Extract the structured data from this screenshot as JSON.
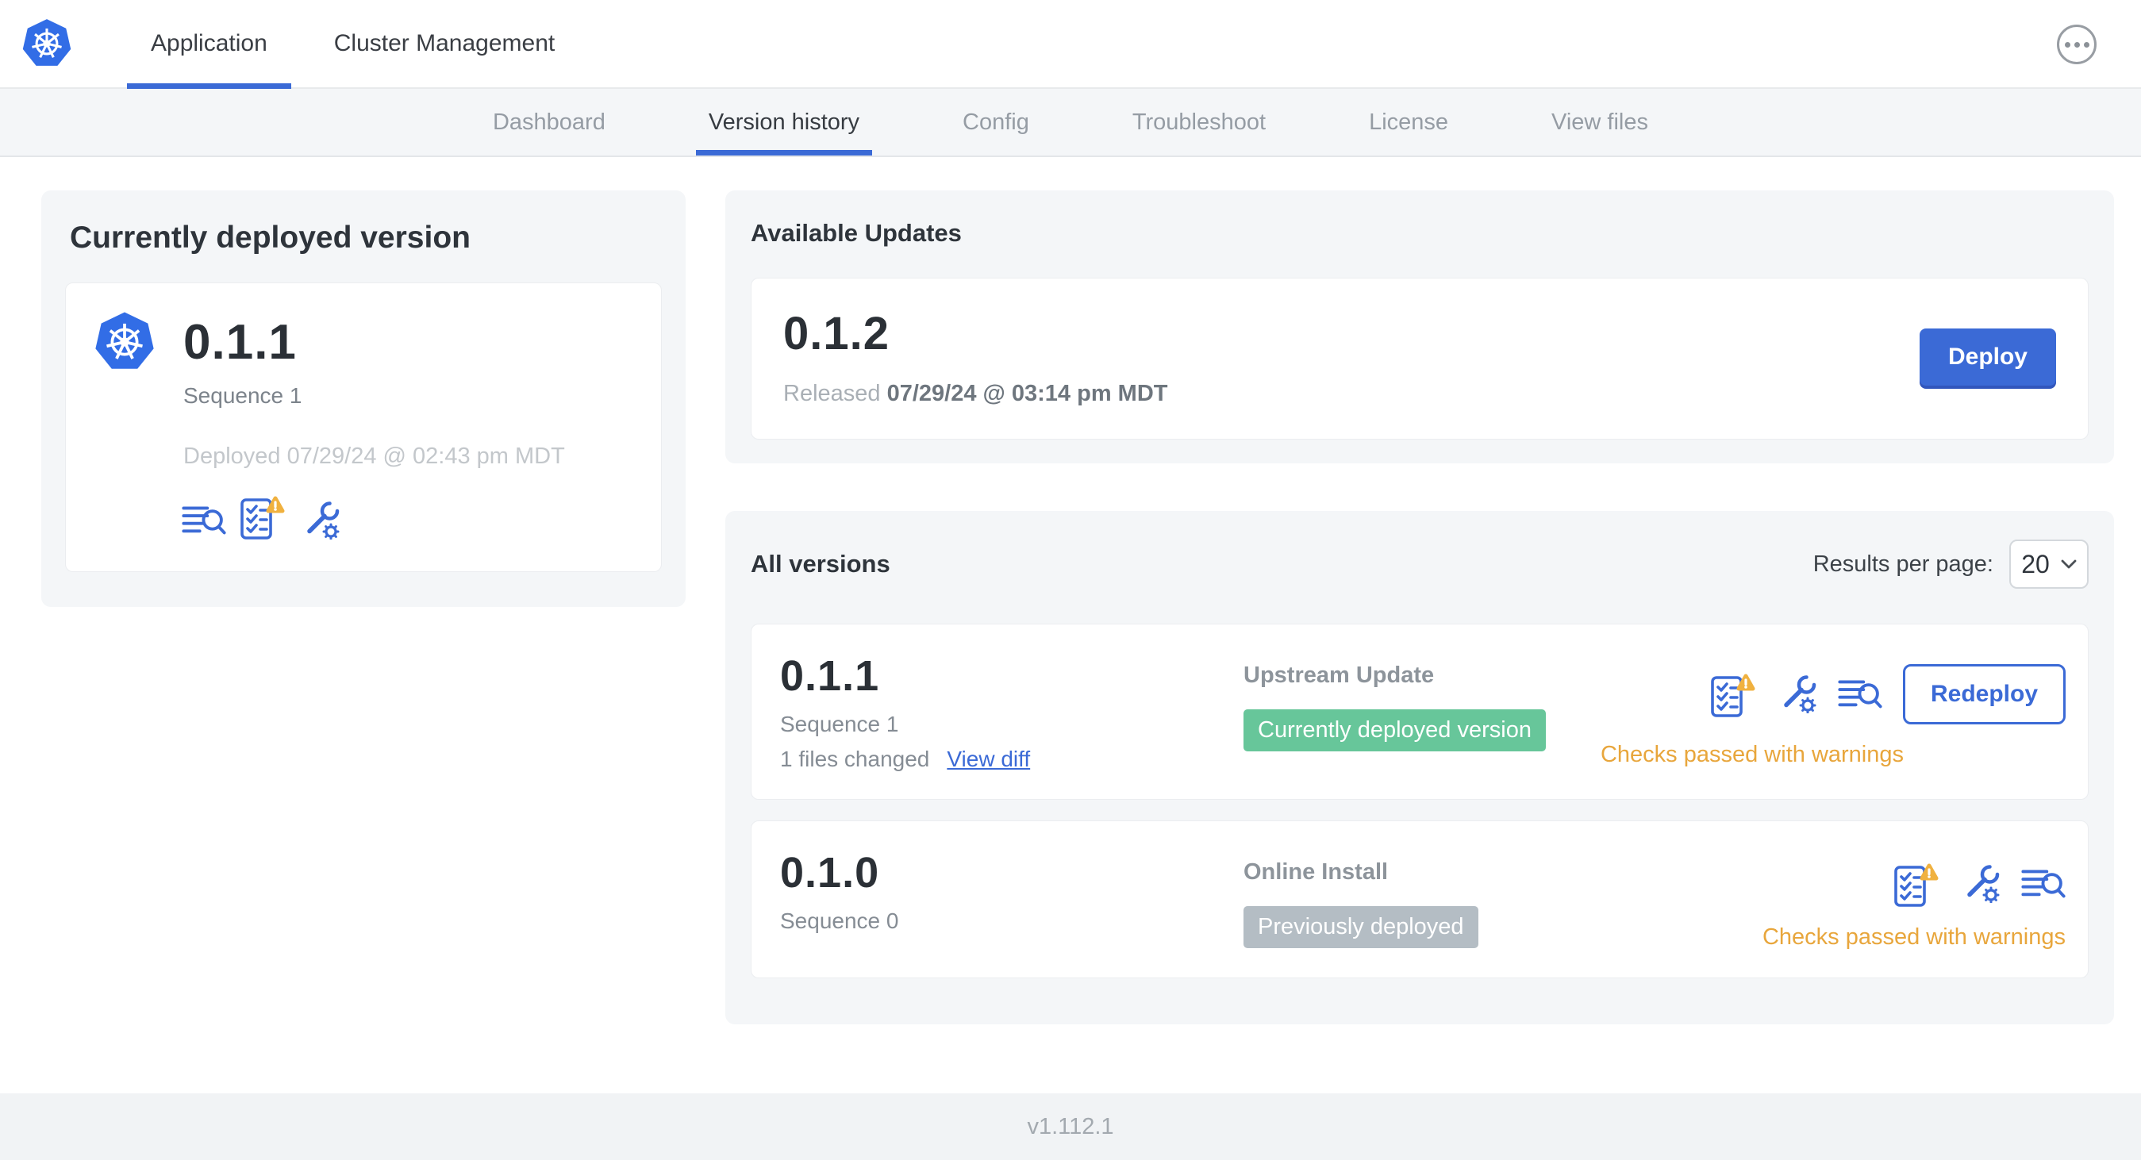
{
  "header": {
    "tabs": [
      {
        "label": "Application",
        "active": true
      },
      {
        "label": "Cluster Management",
        "active": false
      }
    ],
    "more_icon": "ellipsis-in-circle"
  },
  "subnav": {
    "tabs": [
      "Dashboard",
      "Version history",
      "Config",
      "Troubleshoot",
      "License",
      "View files"
    ],
    "active_tab": "Version history"
  },
  "current": {
    "title": "Currently deployed version",
    "version": "0.1.1",
    "sequence": "Sequence 1",
    "deployed": "Deployed 07/29/24 @ 02:43 pm MDT"
  },
  "updates": {
    "title": "Available Updates",
    "version": "0.1.2",
    "released_label": "Released",
    "released_date": "07/29/24 @ 03:14 pm MDT",
    "deploy_label": "Deploy"
  },
  "versions": {
    "title": "All versions",
    "results_label": "Results per page:",
    "results_value": "20",
    "rows": [
      {
        "version": "0.1.1",
        "sequence": "Sequence 1",
        "files_changed": "1 files changed",
        "view_diff_label": "View diff",
        "source": "Upstream Update",
        "badge": "Currently deployed version",
        "action_label": "Redeploy",
        "status": "Checks passed with warnings"
      },
      {
        "version": "0.1.0",
        "sequence": "Sequence 0",
        "source": "Online Install",
        "badge": "Previously deployed",
        "status": "Checks passed with warnings"
      }
    ]
  },
  "footer": {
    "version": "v1.112.1"
  },
  "icons": {
    "logo": "kubernetes-helm-wheel",
    "diff": "log-lines-with-magnifier",
    "preflight": "checklist-with-warning-triangle",
    "config": "wrench-with-gear",
    "more": "three-dots-circle",
    "select": "chevron-down"
  },
  "colors": {
    "accent": "#3b6ad6",
    "logo_blue": "#326de6",
    "green_badge": "#67c69a",
    "gray_badge": "#b4bdc4",
    "warning": "#e8a63c",
    "panel_bg": "#f4f6f8"
  }
}
